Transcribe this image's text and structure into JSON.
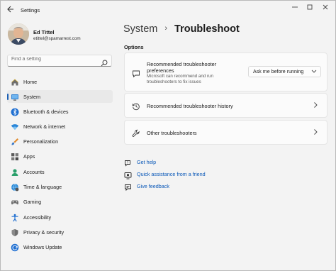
{
  "window": {
    "title": "Settings"
  },
  "user": {
    "name": "Ed Tittel",
    "email": "etittel@spamarrest.com"
  },
  "search": {
    "placeholder": "Find a setting"
  },
  "sidebar": {
    "items": [
      {
        "label": "Home",
        "icon": "home-icon",
        "selected": false
      },
      {
        "label": "System",
        "icon": "monitor-icon",
        "selected": true
      },
      {
        "label": "Bluetooth & devices",
        "icon": "bluetooth-icon",
        "selected": false
      },
      {
        "label": "Network & internet",
        "icon": "wifi-icon",
        "selected": false
      },
      {
        "label": "Personalization",
        "icon": "paintbrush-icon",
        "selected": false
      },
      {
        "label": "Apps",
        "icon": "apps-icon",
        "selected": false
      },
      {
        "label": "Accounts",
        "icon": "person-icon",
        "selected": false
      },
      {
        "label": "Time & language",
        "icon": "globe-clock-icon",
        "selected": false
      },
      {
        "label": "Gaming",
        "icon": "gamepad-icon",
        "selected": false
      },
      {
        "label": "Accessibility",
        "icon": "accessibility-icon",
        "selected": false
      },
      {
        "label": "Privacy & security",
        "icon": "shield-icon",
        "selected": false
      },
      {
        "label": "Windows Update",
        "icon": "update-icon",
        "selected": false
      }
    ]
  },
  "breadcrumb": {
    "parent": "System",
    "separator": "›",
    "current": "Troubleshoot"
  },
  "main": {
    "section_title": "Options",
    "recommended": {
      "title": "Recommended troubleshooter preferences",
      "description": "Microsoft can recommend and run troubleshooters to fix issues",
      "dropdown_value": "Ask me before running"
    },
    "history": {
      "title": "Recommended troubleshooter history"
    },
    "other": {
      "title": "Other troubleshooters"
    }
  },
  "links": {
    "get_help": "Get help",
    "quick_assist": "Quick assistance from a friend",
    "feedback": "Give feedback"
  },
  "colors": {
    "accent": "#1a5fb4",
    "link": "#0a58b8",
    "background": "#f3f3f3",
    "card": "#fbfbfb"
  }
}
